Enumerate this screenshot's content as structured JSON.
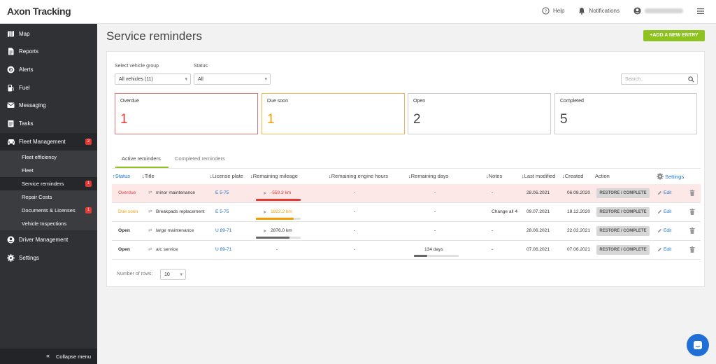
{
  "app": {
    "logo": "Axon Tracking"
  },
  "topbar": {
    "help": "Help",
    "notifications": "Notifications",
    "user_name": "Martin Gustafsson"
  },
  "sidebar": {
    "items": [
      {
        "label": "Map",
        "icon": "map-icon"
      },
      {
        "label": "Reports",
        "icon": "document-icon"
      },
      {
        "label": "Alerts",
        "icon": "alert-icon"
      },
      {
        "label": "Fuel",
        "icon": "fuel-icon"
      },
      {
        "label": "Messaging",
        "icon": "message-icon"
      },
      {
        "label": "Tasks",
        "icon": "tasks-icon"
      },
      {
        "label": "Fleet Management",
        "icon": "car-icon",
        "badge": "2"
      },
      {
        "label": "Driver Management",
        "icon": "user-icon"
      },
      {
        "label": "Settings",
        "icon": "gear-icon"
      }
    ],
    "sub_items": [
      {
        "label": "Fleet efficiency"
      },
      {
        "label": "Fleet"
      },
      {
        "label": "Service reminders",
        "badge": "1"
      },
      {
        "label": "Repair Costs"
      },
      {
        "label": "Documents & Licenses",
        "badge": "1"
      },
      {
        "label": "Vehicle Inspections"
      }
    ],
    "collapse": "Collapse menu"
  },
  "page": {
    "title": "Service reminders",
    "add_button": "+ADD A NEW ENTRY"
  },
  "filters": {
    "group_label": "Select vehicle group",
    "group_value": "All vehicles (11)",
    "status_label": "Status",
    "status_value": "All",
    "search_placeholder": "Search.."
  },
  "cards": [
    {
      "title": "Overdue",
      "value": "1",
      "color": "#e53935"
    },
    {
      "title": "Due soon",
      "value": "1",
      "color": "#f59d00"
    },
    {
      "title": "Open",
      "value": "2",
      "color": "#444444"
    },
    {
      "title": "Completed",
      "value": "5",
      "color": "#444444"
    }
  ],
  "tabs": {
    "active": "Active reminders",
    "completed": "Completed reminders"
  },
  "table": {
    "headers": {
      "status": "↑Status",
      "title": "↓Title",
      "plate": "↓License plate",
      "mileage": "↓Remaining mileage",
      "engine": "↓Remaining engine hours",
      "days": "↓Remaining days",
      "notes": "↓Notes",
      "modified": "↓Last modified",
      "created": "↓Created",
      "action": "Action",
      "settings": "Settings"
    },
    "rows": [
      {
        "status": "Overdue",
        "title": "minor maintenance",
        "plate": "E 5-75",
        "mileage": "-559.3 km",
        "mileage_fill": 1.0,
        "engine": "-",
        "days": "-",
        "notes": "-",
        "modified": "28.06.2021",
        "created": "06.08.2020",
        "action": "RESTORE / COMPLETE",
        "edit": "Edit"
      },
      {
        "status": "Due soon",
        "title": "Breakpads replacement",
        "plate": "E 5-75",
        "mileage": "1822.2 km",
        "mileage_fill": 0.85,
        "engine": "-",
        "days": "-",
        "notes": "Change all 4",
        "modified": "09.07.2021",
        "created": "18.12.2020",
        "action": "RESTORE / COMPLETE",
        "edit": "Edit"
      },
      {
        "status": "Open",
        "title": "large maintenance",
        "plate": "U 89-71",
        "mileage": "2876.0 km",
        "mileage_fill": 0.75,
        "engine": "-",
        "days": "-",
        "notes": "-",
        "modified": "28.06.2021",
        "created": "22.02.2021",
        "action": "RESTORE / COMPLETE",
        "edit": "Edit"
      },
      {
        "status": "Open",
        "title": "a/c service",
        "plate": "U 89-71",
        "mileage": "-",
        "engine": "-",
        "days": "134 days",
        "days_fill": 0.3,
        "notes": "-",
        "modified": "07.06.2021",
        "created": "07.06.2021",
        "action": "RESTORE / COMPLETE",
        "edit": "Edit"
      }
    ]
  },
  "pagination": {
    "rows_label": "Number of rows:",
    "rows_value": "10"
  },
  "colors": {
    "accent": "#8dc21f",
    "link": "#1a75d2",
    "danger": "#e53935",
    "warning": "#f59d00",
    "sidebar": "#2f3135"
  }
}
